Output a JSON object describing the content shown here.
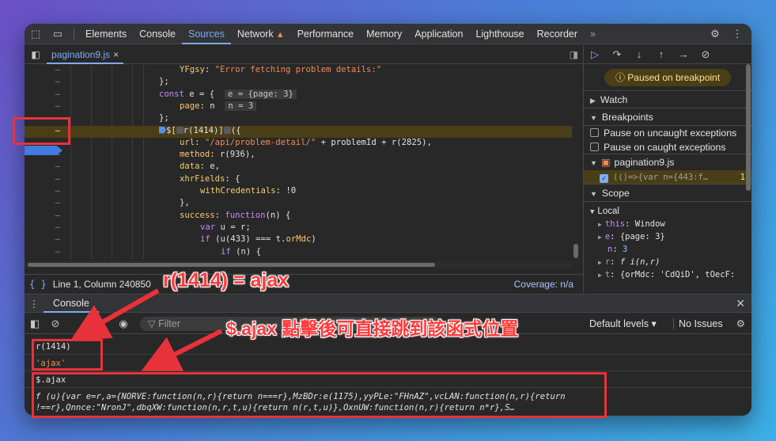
{
  "topbar": {
    "tabs": [
      "Elements",
      "Console",
      "Sources",
      "Network",
      "Performance",
      "Memory",
      "Application",
      "Lighthouse",
      "Recorder"
    ],
    "active_tab": "Sources",
    "network_warning": "warning-triangle-icon",
    "more_tabs_glyph": "»"
  },
  "file_tab": {
    "name": "pagination9.js",
    "close": "×"
  },
  "code_lines": [
    {
      "ln": "–",
      "html_key": "l1"
    },
    {
      "ln": "–",
      "html_key": "l2"
    },
    {
      "ln": "–",
      "html_key": "l3"
    },
    {
      "ln": "–",
      "html_key": "l4"
    },
    {
      "ln": "–",
      "html_key": "l5"
    },
    {
      "ln": "–",
      "html_key": "l6"
    },
    {
      "ln": "–",
      "html_key": "l7"
    },
    {
      "ln": "–",
      "html_key": "l8"
    },
    {
      "ln": "–",
      "html_key": "l9"
    },
    {
      "ln": "–",
      "html_key": "l10"
    },
    {
      "ln": "–",
      "html_key": "l11"
    },
    {
      "ln": "–",
      "html_key": "l12"
    },
    {
      "ln": "–",
      "html_key": "l13"
    },
    {
      "ln": "–",
      "html_key": "l14"
    },
    {
      "ln": "–",
      "html_key": "l15"
    },
    {
      "ln": "–",
      "html_key": "l16"
    }
  ],
  "code": {
    "l1_prop": "YFgsy",
    "l1_str": "\"Error fetching problem details:\"",
    "l2": "};",
    "l3_kw": "const",
    "l3_rest": " e = {",
    "l3_inline": "e = {page: 3}",
    "l4_prop": "page",
    "l4_rest": ": n",
    "l4_inline": "n = 3",
    "l5": "};",
    "l6": "$[",
    "l6_call": "r(1414)",
    "l6_end": "]",
    "l6_tail": "({",
    "l7_prop": "url",
    "l7_str": "\"/api/problem-detail/\"",
    "l7_rest": " + problemId + r(2825),",
    "l8_prop": "method",
    "l8_rest": ": r(936),",
    "l9_prop": "data",
    "l9_rest": ": e,",
    "l10_prop": "xhrFields",
    "l10_rest": ": {",
    "l11_prop": "withCredentials",
    "l11_rest": ": !0",
    "l12": "},",
    "l13_prop": "success",
    "l13_kw": "function",
    "l13_rest": "(n) {",
    "l14_kw": "var",
    "l14_rest": " u = r;",
    "l15_kw": "if",
    "l15_rest": " (u(433) === t.",
    "l15_prop": "orMdc",
    "l15_end": ")",
    "l16_kw": "if",
    "l16_rest": " (n) {"
  },
  "status": {
    "position": "Line 1, Column 240850",
    "coverage": "Coverage: n/a"
  },
  "debugger": {
    "paused_label": "Paused on breakpoint",
    "watch": "Watch",
    "breakpoints": "Breakpoints",
    "pause_uncaught": "Pause on uncaught exceptions",
    "pause_caught": "Pause on caught exceptions",
    "bp_file": "pagination9.js",
    "bp_code": "(()=>{var n={443:f…",
    "bp_count": "1",
    "scope": "Scope",
    "local": "Local",
    "scope_items": [
      {
        "key": "this",
        "val": "Window"
      },
      {
        "key": "e",
        "val": "{page: 3}"
      },
      {
        "key": "n",
        "val": "3"
      },
      {
        "key": "r",
        "val": "f i(n,r)"
      },
      {
        "key": "t",
        "val": "{orMdc: 'CdQiD', tOecF:"
      }
    ]
  },
  "console": {
    "tab": "Console",
    "filter_placeholder": "Filter",
    "levels": "Default levels ▾",
    "issues": "No Issues",
    "entries": [
      {
        "kind": "input",
        "text": "r(1414)"
      },
      {
        "kind": "output",
        "text": "'ajax'"
      },
      {
        "kind": "input",
        "text": "$.ajax"
      },
      {
        "kind": "output_fn",
        "text": "f (u){var e=r,a={NORVE:function(n,r){return n===r},MzBDr:e(1175),yyPLe:\"FHnAZ\",vcLAN:function(n,r){return\n!==r},Qnnce:\"NronJ\",dbqXW:function(n,r,t,u){return n(r,t,u)},OxnUW:function(n,r){return n*r},S…"
      }
    ]
  },
  "annotations": {
    "label1": "r(1414) = ajax",
    "label2": "$.ajax 點擊後可直接跳到該函式位置",
    "color": "#e8323a"
  }
}
